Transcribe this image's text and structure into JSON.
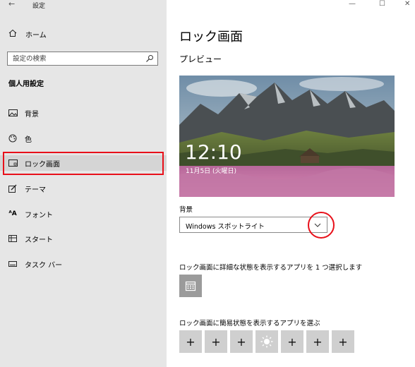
{
  "window": {
    "title": "設定",
    "minimize": "—",
    "maximize": "☐",
    "close": "✕"
  },
  "sidebar": {
    "home_label": "ホーム",
    "search": {
      "placeholder": "設定の検索"
    },
    "section_title": "個人用設定",
    "items": [
      {
        "label": "背景",
        "icon": "picture-icon"
      },
      {
        "label": "色",
        "icon": "palette-icon"
      },
      {
        "label": "ロック画面",
        "icon": "lock-screen-icon",
        "selected": true
      },
      {
        "label": "テーマ",
        "icon": "theme-brush-icon"
      },
      {
        "label": "フォント",
        "icon": "font-icon"
      },
      {
        "label": "スタート",
        "icon": "start-icon"
      },
      {
        "label": "タスク バー",
        "icon": "taskbar-icon"
      }
    ]
  },
  "main": {
    "title": "ロック画面",
    "preview_title": "プレビュー",
    "preview": {
      "time": "12:10",
      "date": "11月5日 (火曜日)"
    },
    "background_label": "背景",
    "background_value": "Windows スポットライト",
    "detail_label": "ロック画面に詳細な状態を表示するアプリを 1 つ選択します",
    "quick_label": "ロック画面に簡易状態を表示するアプリを選ぶ",
    "quick_tiles": [
      "+",
      "+",
      "+",
      "weather-sun-icon",
      "+",
      "+",
      "+"
    ]
  },
  "colors": {
    "sidebar_bg": "#e6e6e6",
    "highlight_red": "#e8101a",
    "tile_gray": "#cfcfcf"
  }
}
